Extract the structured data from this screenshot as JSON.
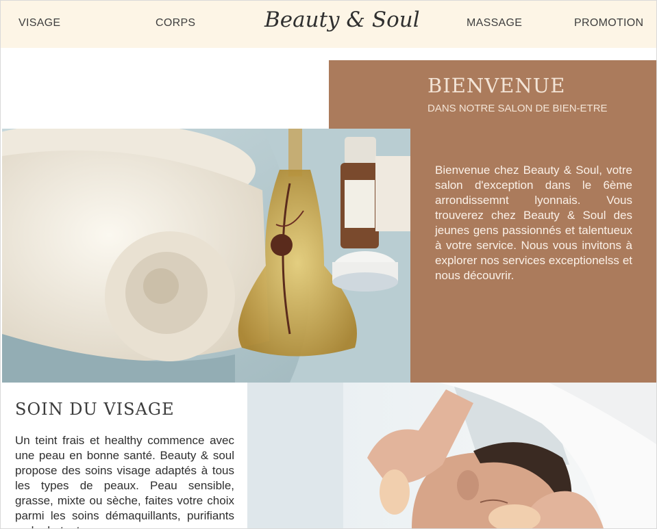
{
  "header": {
    "nav_left": [
      "VISAGE",
      "CORPS"
    ],
    "nav_right": [
      "MASSAGE",
      "PROMOTION"
    ],
    "logo": "Beauty & Soul"
  },
  "welcome": {
    "title": "BIENVENUE",
    "subtitle": "DANS NOTRE SALON DE BIEN-ETRE",
    "text": "Bienvenue chez Beauty & Soul, votre salon d'exception dans le 6ème arrondissemnt lyonnais. Vous trouverez chez Beauty & Soul des jeunes gens passionnés et talentueux à votre service. Nous vous invitons à explorer nos services exceptionelss et nous découvrir."
  },
  "soin": {
    "title": "SOIN DU VISAGE",
    "text": "Un teint frais et healthy commence avec une peau en bonne santé. Beauty & soul propose des soins visage adaptés à tous les types de peaux. Peau sensible, grasse, mixte ou sèche, faites votre choix parmi les soins démaquillants, purifiants ou hydratants."
  },
  "colors": {
    "header_bg": "#fdf5e6",
    "accent_brown": "#ab7b5c",
    "text_dark": "#3e3e3e"
  }
}
